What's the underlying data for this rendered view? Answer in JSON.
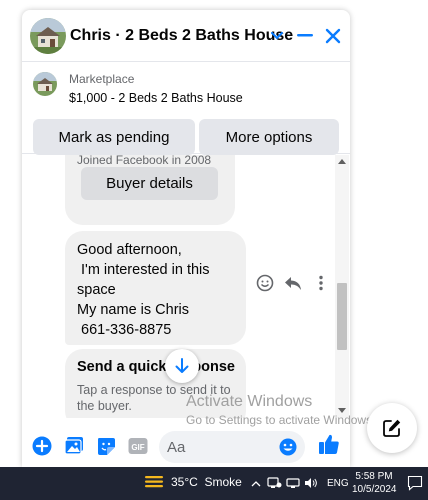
{
  "header": {
    "title": "Chris · 2 Beds 2 Baths House",
    "icons": [
      "house-avatar",
      "chevron-down-icon",
      "minimize-icon",
      "close-icon"
    ]
  },
  "listing": {
    "source": "Marketplace",
    "title": "$1,000 - 2 Beds 2 Baths House",
    "mark_pending": "Mark as pending",
    "more_options": "More options"
  },
  "messages": {
    "joined": "Joined Facebook in 2008",
    "buyer_details": "Buyer details",
    "message_text": "Good afternoon,\n I'm interested in this\nspace\nMy name is Chris\n 661-336-8875",
    "quick_title": "Send a quick response",
    "quick_subtitle": "Tap a response to send it to the buyer."
  },
  "composer": {
    "placeholder": "Aa",
    "icons": [
      "plus-icon",
      "photo-icon",
      "sticker-icon",
      "gif-icon",
      "emoji-icon",
      "like-icon"
    ]
  },
  "watermark": {
    "line1": "Activate Windows",
    "line2": "Go to Settings to activate Windows."
  },
  "taskbar": {
    "weather": "35°C  Smoke",
    "language": "ENG",
    "time": "5:58 PM",
    "date": "10/5/2024"
  },
  "colors": {
    "accent": "#0a7cff",
    "bubble": "#f0f0f0",
    "button": "#e4e6eb",
    "taskbar": "#1f2433"
  }
}
